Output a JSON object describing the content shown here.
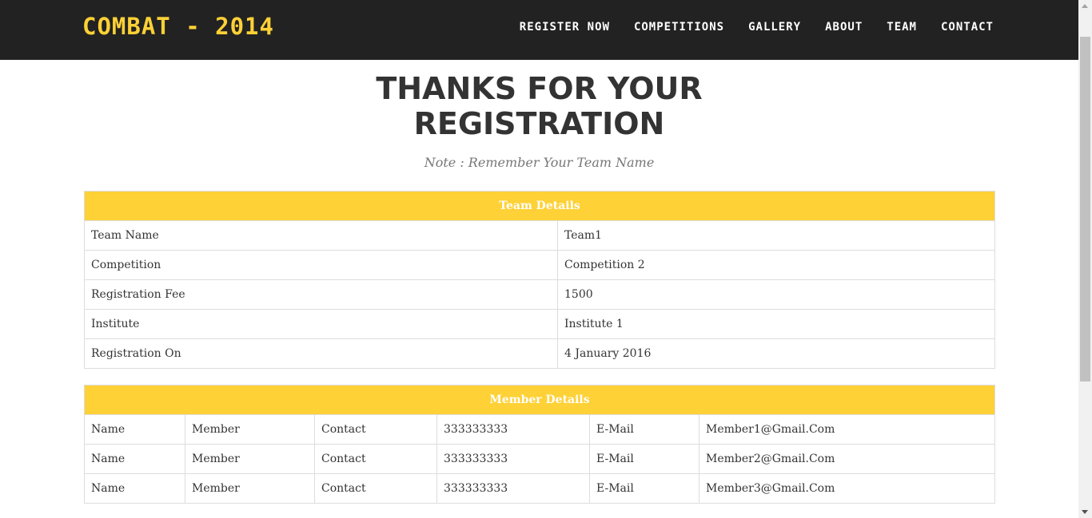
{
  "nav": {
    "brand": "COMBAT - 2014",
    "links": [
      "REGISTER NOW",
      "COMPETITIONS",
      "GALLERY",
      "ABOUT",
      "TEAM",
      "CONTACT"
    ]
  },
  "page": {
    "title_line1": "THANKS FOR YOUR",
    "title_line2": "REGISTRATION",
    "note": "Note : Remember Your Team Name"
  },
  "team_details": {
    "header": "Team Details",
    "rows": [
      {
        "label": "Team Name",
        "value": "Team1"
      },
      {
        "label": "Competition",
        "value": "Competition 2"
      },
      {
        "label": "Registration Fee",
        "value": "1500"
      },
      {
        "label": "Institute",
        "value": "Institute 1"
      },
      {
        "label": "Registration On",
        "value": "4 January 2016"
      }
    ]
  },
  "member_details": {
    "header": "Member Details",
    "rows": [
      {
        "name_label": "Name",
        "name": "Member",
        "contact_label": "Contact",
        "contact": "333333333",
        "email_label": "E-Mail",
        "email": "Member1@Gmail.Com"
      },
      {
        "name_label": "Name",
        "name": "Member",
        "contact_label": "Contact",
        "contact": "333333333",
        "email_label": "E-Mail",
        "email": "Member2@Gmail.Com"
      },
      {
        "name_label": "Name",
        "name": "Member",
        "contact_label": "Contact",
        "contact": "333333333",
        "email_label": "E-Mail",
        "email": "Member3@Gmail.Com"
      }
    ]
  },
  "colors": {
    "accent": "#fed136",
    "navbar": "#222222"
  }
}
